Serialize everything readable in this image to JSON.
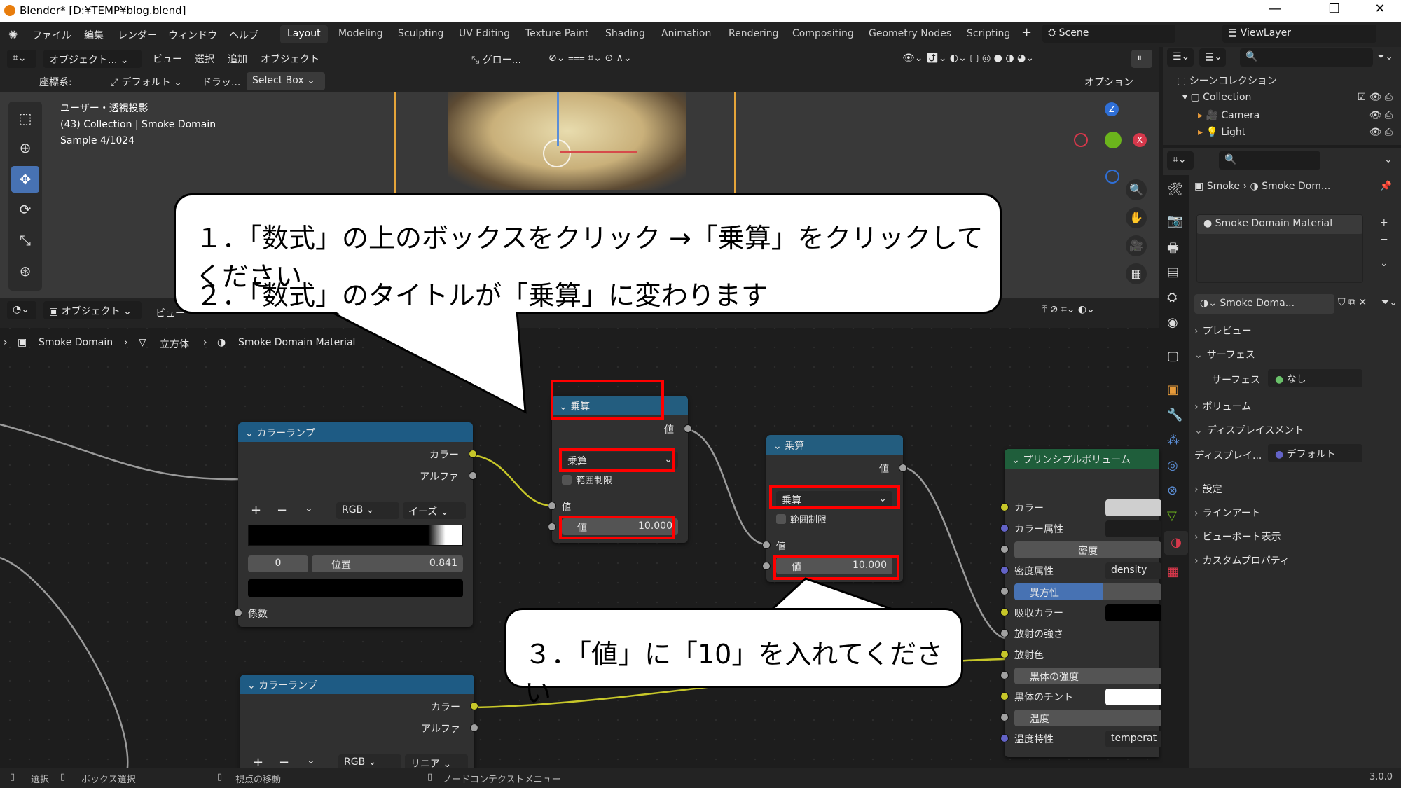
{
  "window": {
    "title": "Blender* [D:¥TEMP¥blog.blend]",
    "version": "3.0.0"
  },
  "menus": [
    "ファイル",
    "編集",
    "レンダー",
    "ウィンドウ",
    "ヘルプ"
  ],
  "workspaces": [
    "Layout",
    "Modeling",
    "Sculpting",
    "UV Editing",
    "Texture Paint",
    "Shading",
    "Animation",
    "Rendering",
    "Compositing",
    "Geometry Nodes",
    "Scripting"
  ],
  "scene": "Scene",
  "viewlayer": "ViewLayer",
  "viewport_header": {
    "mode": "オブジェクト...",
    "view": "ビュー",
    "select": "選択",
    "add": "追加",
    "object": "オブジェクト",
    "orientation": "グロー...",
    "coords_label": "座標系:",
    "coords_value": "デフォルト",
    "drag": "ドラッ...",
    "select_box": "Select Box",
    "options": "オプション"
  },
  "viewport_info": {
    "line1": "ユーザー・透視投影",
    "line2": "(43) Collection | Smoke Domain",
    "line3": "Sample 4/1024"
  },
  "node_header": {
    "mode": "オブジェクト",
    "view": "ビュー"
  },
  "breadcrumb": [
    "Smoke Domain",
    "立方体",
    "Smoke Domain Material"
  ],
  "outliner": {
    "title": "シーンコレクション",
    "collection": "Collection",
    "items": [
      "Camera",
      "Light"
    ]
  },
  "properties": {
    "path_obj": "Smoke",
    "path_mat": "Smoke Dom...",
    "material_slot": "Smoke Domain Material",
    "material_name": "Smoke Doma...",
    "panels": {
      "preview": "プレビュー",
      "surface": "サーフェス",
      "surface_label": "サーフェス",
      "surface_value": "なし",
      "volume": "ボリューム",
      "displacement": "ディスプレイスメント",
      "disp_label": "ディスプレイ...",
      "disp_value": "デフォルト",
      "settings": "設定",
      "lineart": "ラインアート",
      "viewport_display": "ビューポート表示",
      "custom_props": "カスタムプロパティ"
    }
  },
  "nodes": {
    "ramp1": {
      "title": "カラーランプ",
      "out_color": "カラー",
      "out_alpha": "アルファ",
      "mode": "RGB",
      "interp": "イーズ",
      "index": "0",
      "pos_label": "位置",
      "pos_value": "0.841",
      "in_fac": "係数"
    },
    "ramp2": {
      "title": "カラーランプ",
      "out_color": "カラー",
      "out_alpha": "アルファ",
      "mode": "RGB",
      "interp": "リニア"
    },
    "math1": {
      "title": "乗算",
      "out": "値",
      "op": "乗算",
      "clamp": "範囲制限",
      "in_val": "値",
      "val_label": "値",
      "val": "10.000"
    },
    "math2": {
      "title": "乗算",
      "out": "値",
      "op": "乗算",
      "clamp": "範囲制限",
      "in_val": "値",
      "val_label": "値",
      "val": "10.000"
    },
    "vol": {
      "title": "プリンシプルボリューム",
      "rows": [
        "カラー",
        "カラー属性",
        "密度",
        "密度属性",
        "異方性",
        "吸収カラー",
        "放射の強さ",
        "放射色",
        "黒体の強度",
        "黒体のチント",
        "温度",
        "温度特性"
      ],
      "density_attr": "density",
      "temp_attr": "temperat"
    }
  },
  "callouts": {
    "c1": "１．「数式」の上のボックスをクリック →「乗算」をクリックしてください",
    "c2": "２．「数式」のタイトルが「乗算」に変わります",
    "c3": "３．「値」に「10」を入れてください"
  },
  "status": {
    "select": "選択",
    "box_select": "ボックス選択",
    "pan": "視点の移動",
    "context": "ノードコンテクストメニュー"
  },
  "colors": {
    "accent": "#4772b3",
    "highlight": "#ff0000",
    "socket_yellow": "#c7c729"
  }
}
